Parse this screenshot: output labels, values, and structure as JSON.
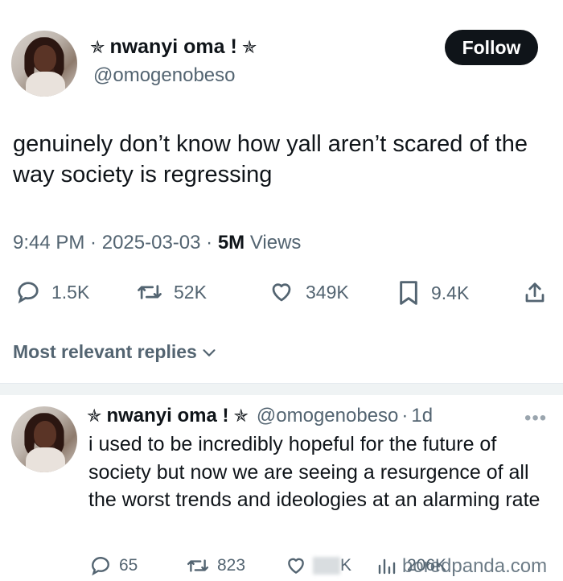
{
  "main_tweet": {
    "display_name": "nwanyi oma !",
    "handle": "@omogenobeso",
    "follow_label": "Follow",
    "text": "genuinely don’t know how yall aren’t scared of the way society is regressing",
    "time": "9:44 PM",
    "date": "2025-03-03",
    "views": "5M",
    "views_label": "Views",
    "actions": {
      "replies": "1.5K",
      "retweets": "52K",
      "likes": "349K",
      "bookmarks": "9.4K"
    }
  },
  "replies_section": {
    "label": "Most relevant replies"
  },
  "reply": {
    "display_name": "nwanyi oma !",
    "handle": "@omogenobeso",
    "age": "1d",
    "text": "i used to be incredibly hopeful for the future of society but now we are seeing a resurgence of all the worst trends and ideologies  at an alarming rate",
    "actions": {
      "replies": "65",
      "retweets": "823",
      "likes": "K",
      "views": "206K"
    }
  },
  "watermark": "boredpanda.com",
  "icons": [
    "star-icon",
    "reply-icon",
    "retweet-icon",
    "like-icon",
    "bookmark-icon",
    "share-icon",
    "chevron-down-icon",
    "more-icon",
    "views-icon"
  ]
}
